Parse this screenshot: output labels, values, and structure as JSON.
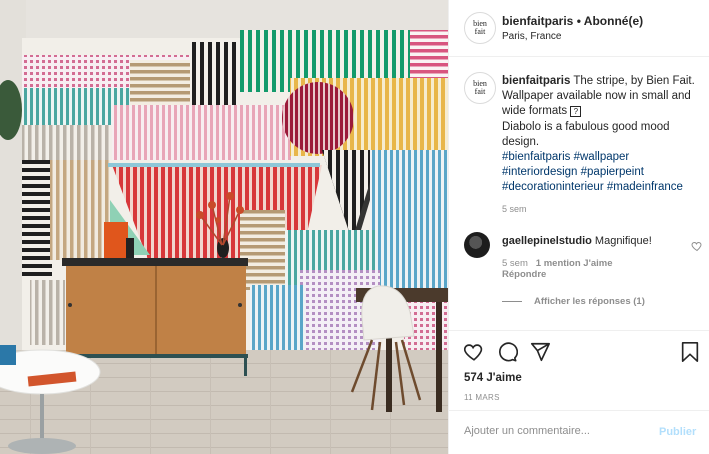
{
  "post": {
    "username": "bienfaitparis",
    "separator": " • ",
    "follow_label": "Abonné(e)",
    "location": "Paris, France",
    "avatar_text_1": "bien",
    "avatar_text_2": "fait"
  },
  "caption": {
    "username": "bienfaitparis",
    "text": " The stripe, by Bien Fait. Wallpaper available now in small and wide formats ",
    "emoji_box": "?",
    "text2": "Diabolo is a fabulous good mood design.",
    "tags": [
      "#bienfaitparis",
      "#wallpaper",
      "#interiordesign",
      "#papierpeint",
      "#decorationinterieur",
      "#madeinfrance"
    ],
    "time": "5 sem"
  },
  "comment": {
    "username": "gaellepinelstudio",
    "text": " Magnifique!",
    "time": "5 sem",
    "likes": "1 mention J'aime",
    "reply": "Répondre"
  },
  "view_replies": "Afficher les réponses (1)",
  "actions": {
    "likes_count": "574 J'aime",
    "date": "11 MARS"
  },
  "add_comment": {
    "placeholder": "Ajouter un commentaire...",
    "publish": "Publier"
  },
  "colors": {
    "link": "#00376b",
    "muted": "#8e8e8e",
    "publish_disabled": "#b2dffc",
    "border": "#efefef"
  },
  "icons": [
    "heart-icon",
    "comment-icon",
    "share-icon",
    "bookmark-icon",
    "small-heart-icon"
  ]
}
